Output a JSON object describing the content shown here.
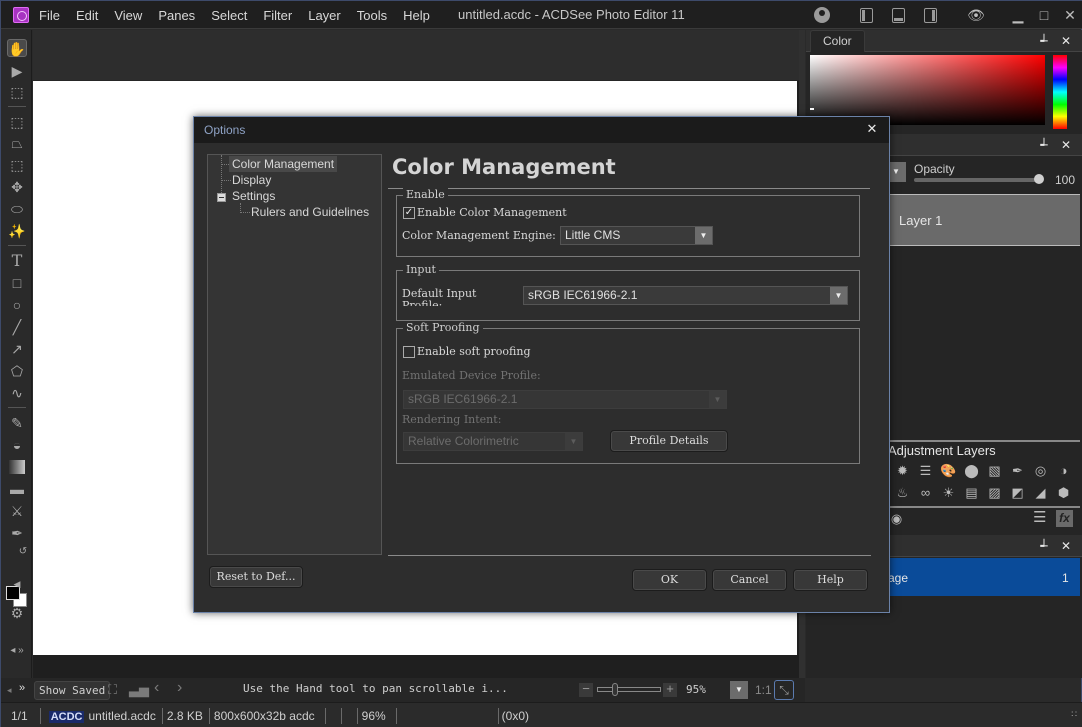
{
  "app": {
    "window_title": "untitled.acdc - ACDSee Photo Editor 11",
    "menu": [
      "File",
      "Edit",
      "View",
      "Panes",
      "Select",
      "Filter",
      "Layer",
      "Tools",
      "Help"
    ],
    "title_icons": [
      "user-account-icon",
      "layout-left-icon",
      "layout-bottom-icon",
      "layout-right-icon",
      "visibility-icon",
      "minimize-icon",
      "maximize-icon",
      "close-icon"
    ]
  },
  "toolbar": {
    "tools": [
      "hand-tool",
      "move-tool",
      "marquee-select-tool",
      "quick-select-tool",
      "polygon-lasso-tool",
      "transform-tool",
      "warp-tool",
      "lasso-tool",
      "magic-wand-tool",
      "text-tool",
      "rectangle-tool",
      "ellipse-tool",
      "line-tool",
      "arrow-tool",
      "polygon-tool",
      "bezier-tool",
      "brush-tool",
      "bucket-fill-tool",
      "gradient-tool",
      "eraser-tool",
      "clone-tool",
      "eyedropper-tool",
      "swap-colors",
      "foreground-color",
      "background-color",
      "settings-tool"
    ],
    "foreground_color": "#000000",
    "background_color": "#ffffff"
  },
  "navbar": {
    "show_saved_label": "Show Saved",
    "hint": "Use the Hand tool to pan scrollable i...",
    "zoom_value": "95%",
    "zoom_percent": 95,
    "one_to_one": "1:1"
  },
  "statusbar": {
    "page": "1/1",
    "format_badge": "ACDC",
    "filename": "untitled.acdc",
    "filesize": "2.8 KB",
    "dimensions": "800x600x32b acdc",
    "zoom": "96%",
    "coords": "(0x0)"
  },
  "panels": {
    "color": {
      "tab_label": "Color",
      "hue_color": "#ff0000"
    },
    "layers": {
      "opacity_label": "Opacity",
      "opacity_value": "100",
      "layer_name": "Layer 1",
      "adjustment_title": "Adjustment Layers",
      "adjustment_icons_row1": [
        "exposure-icon",
        "levels-icon",
        "color-balance-icon",
        "channel-mixer-icon",
        "curves-icon",
        "dropper-icon",
        "blend-icon",
        "contrast-icon"
      ],
      "adjustment_icons_row2": [
        "splash-icon",
        "glasses-icon",
        "sunset-icon",
        "gradient-map-icon",
        "photo-icon",
        "tone-icon",
        "histogram-icon",
        "cube-icon"
      ]
    },
    "pages": {
      "page_label": "age",
      "page_number": "1"
    }
  },
  "dialog": {
    "title": "Options",
    "tree": [
      {
        "label": "Color Management",
        "selected": true
      },
      {
        "label": "Display"
      },
      {
        "label": "Settings",
        "expanded": true
      },
      {
        "label": "Rulers and Guidelines"
      }
    ],
    "heading": "Color Management",
    "enable_group": {
      "legend": "Enable",
      "checkbox_label": "Enable Color Management",
      "checked": true,
      "engine_label": "Color Management Engine:",
      "engine_value": "Little CMS"
    },
    "input_group": {
      "legend": "Input",
      "profile_label_line1": "Default Input",
      "profile_label_line2": "Profile:",
      "profile_value": "sRGB IEC61966-2.1"
    },
    "proofing_group": {
      "legend": "Soft Proofing",
      "checkbox_label": "Enable soft proofing",
      "checked": false,
      "device_label": "Emulated Device Profile:",
      "device_value": "sRGB IEC61966-2.1",
      "intent_label": "Rendering Intent:",
      "intent_value": "Relative Colorimetric",
      "details_button": "Profile Details"
    },
    "buttons": {
      "reset": "Reset to Def...",
      "ok": "OK",
      "cancel": "Cancel",
      "help": "Help"
    }
  }
}
